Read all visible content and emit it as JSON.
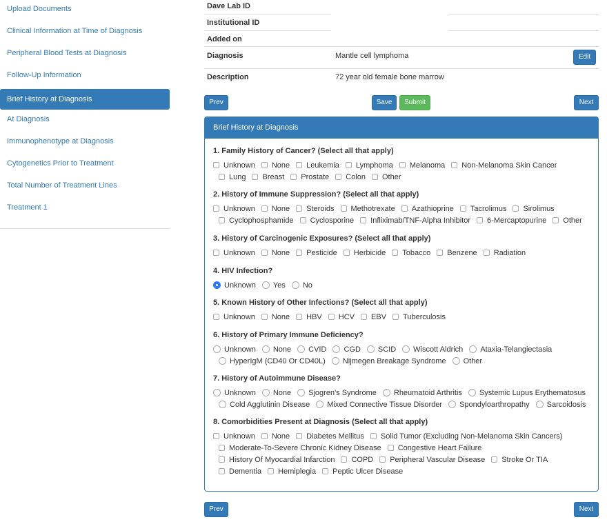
{
  "sidebar": {
    "items": [
      {
        "label": "Upload Documents"
      },
      {
        "label": "Clinical Information at Time of Diagnosis"
      },
      {
        "label": "Peripheral Blood Tests at Diagnosis"
      },
      {
        "label": "Follow-Up Information"
      },
      {
        "label": "Brief History at Diagnosis",
        "active": true
      },
      {
        "label": "At Diagnosis"
      },
      {
        "label": "Immunophenotype at Diagnosis"
      },
      {
        "label": "Cytogenetics Prior to Treatment"
      },
      {
        "label": "Total Number of Treatment Lines"
      },
      {
        "label": "Treatment 1"
      }
    ]
  },
  "info": {
    "dave_lab_id_label": "Dave Lab ID",
    "institutional_id_label": "Institutional ID",
    "added_on_label": "Added on",
    "diagnosis_label": "Diagnosis",
    "diagnosis_value": "Mantle cell lymphoma",
    "edit_button": "Edit",
    "description_label": "Description",
    "description_value": "72 year old female bone marrow"
  },
  "nav": {
    "prev": "Prev",
    "save": "Save",
    "submit": "Submit",
    "next": "Next"
  },
  "panel": {
    "title": "Brief History at Diagnosis",
    "questions": [
      {
        "title": "1. Family History of Cancer? (Select all that apply)",
        "type": "checkbox",
        "lines": [
          [
            "Unknown",
            "None",
            "Leukemia",
            "Lymphoma",
            "Melanoma",
            "Non-Melanoma Skin Cancer"
          ],
          [
            "Lung",
            "Breast",
            "Prostate",
            "Colon",
            "Other"
          ]
        ]
      },
      {
        "title": "2. History of Immune Suppression? (Select all that apply)",
        "type": "checkbox",
        "lines": [
          [
            "Unknown",
            "None",
            "Steroids",
            "Methotrexate",
            "Azathioprine",
            "Tacrolimus",
            "Sirolimus"
          ],
          [
            "Cyclophosphamide",
            "Cyclosporine",
            "Infliximab/TNF-Alpha Inhibitor",
            "6-Mercaptopurine",
            "Other"
          ]
        ]
      },
      {
        "title": "3. History of Carcinogenic Exposures? (Select all that apply)",
        "type": "checkbox",
        "lines": [
          [
            "Unknown",
            "None",
            "Pesticide",
            "Herbicide",
            "Tobacco",
            "Benzene",
            "Radiation"
          ]
        ]
      },
      {
        "title": "4. HIV Infection?",
        "type": "radio",
        "selected": "Unknown",
        "lines": [
          [
            "Unknown",
            "Yes",
            "No"
          ]
        ]
      },
      {
        "title": "5. Known History of Other Infections? (Select all that apply)",
        "type": "checkbox",
        "lines": [
          [
            "Unknown",
            "None",
            "HBV",
            "HCV",
            "EBV",
            "Tuberculosis"
          ]
        ]
      },
      {
        "title": "6. History of Primary Immune Deficiency?",
        "type": "radio",
        "lines": [
          [
            "Unknown",
            "None",
            "CVID",
            "CGD",
            "SCID",
            "Wiscott Aldrich",
            "Ataxia-Telangiectasia"
          ],
          [
            "HyperIgM (CD40 Or CD40L)",
            "Nijmegen Breakage Syndrome",
            "Other"
          ]
        ]
      },
      {
        "title": "7. History of Autoimmune Disease?",
        "type": "radio",
        "lines": [
          [
            "Unknown",
            "None",
            "Sjogren's Syndrome",
            "Rheumatoid Arthritis",
            "Systemic Lupus Erythematosus"
          ],
          [
            "Cold Agglutinin Disease",
            "Mixed Connective Tissue Disorder",
            "Spondyloarthropathy",
            "Sarcoidosis"
          ]
        ]
      },
      {
        "title": "8. Comorbidities Present at Diagnosis (Select all that apply)",
        "type": "checkbox",
        "lines": [
          [
            "Unknown",
            "None",
            "Diabetes Mellitus",
            "Solid Tumor (Excluding Non-Melanoma Skin Cancers)"
          ],
          [
            "Moderate-To-Severe Chronic Kidney Disease",
            "Congestive Heart Failure"
          ],
          [
            "History Of Myocardial Infarction",
            "COPD",
            "Peripheral Vascular Disease",
            "Stroke Or TIA"
          ],
          [
            "Dementia",
            "Hemiplegia",
            "Peptic Ulcer Disease"
          ]
        ]
      }
    ]
  },
  "colors": {
    "primary": "#337ab7",
    "success": "#5cb85c",
    "radio_selected": "#2b7cf6"
  }
}
